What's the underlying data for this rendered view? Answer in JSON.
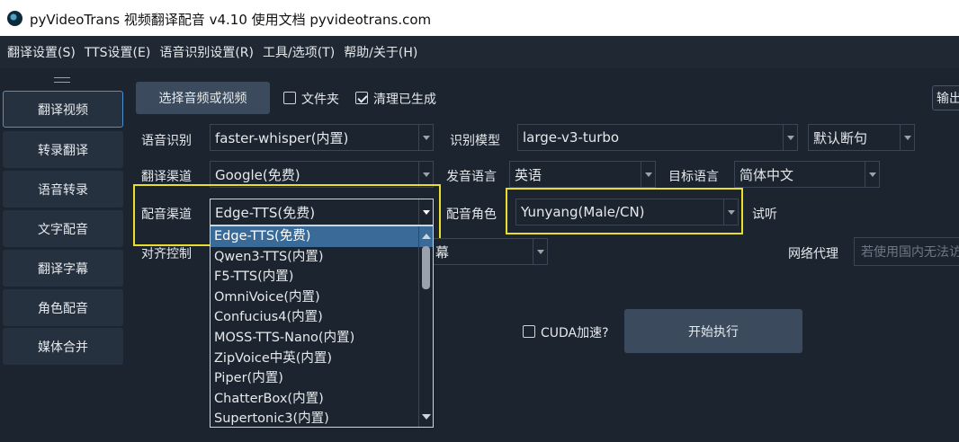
{
  "window": {
    "title": "pyVideoTrans 视频翻译配音 v4.10 使用文档 pyvideotrans.com"
  },
  "menu": [
    "翻译设置(S)",
    "TTS设置(E)",
    "语音识别设置(R)",
    "工具/选项(T)",
    "帮助/关于(H)"
  ],
  "sidebar": {
    "items": [
      {
        "label": "翻译视频",
        "active": true
      },
      {
        "label": "转录翻译"
      },
      {
        "label": "语音转录"
      },
      {
        "label": "文字配音"
      },
      {
        "label": "翻译字幕"
      },
      {
        "label": "角色配音"
      },
      {
        "label": "媒体合并"
      }
    ]
  },
  "top": {
    "select_button": "选择音频或视频",
    "folder_checkbox": "文件夹",
    "clear_checkbox": "清理已生成",
    "output_button": "输出"
  },
  "form": {
    "asr_label": "语音识别",
    "asr_value": "faster-whisper(内置)",
    "model_label": "识别模型",
    "model_value": "large-v3-turbo",
    "split_value": "默认断句",
    "translate_label": "翻译渠道",
    "translate_value": "Google(免费)",
    "source_lang_label": "发音语言",
    "source_lang_value": "英语",
    "target_lang_label": "目标语言",
    "target_lang_value": "简体中文",
    "dub_label": "配音渠道",
    "dub_value": "Edge-TTS(免费)",
    "role_label": "配音角色",
    "role_value": "Yunyang(Male/CN)",
    "listen_label": "试听",
    "align_label": "对齐控制",
    "subtitle_partial": "幕",
    "proxy_label": "网络代理",
    "proxy_placeholder": "若使用国内无法访"
  },
  "dropdown": {
    "options": [
      "Edge-TTS(免费)",
      "Qwen3-TTS(内置)",
      "F5-TTS(内置)",
      "OmniVoice(内置)",
      "Confucius4(内置)",
      "MOSS-TTS-Nano(内置)",
      "ZipVoice中英(内置)",
      "Piper(内置)",
      "ChatterBox(内置)",
      "Supertonic3(内置)"
    ],
    "selected_index": 0
  },
  "bottom": {
    "cuda_label": "CUDA加速?",
    "start_button": "开始执行"
  },
  "colors": {
    "highlight": "#e9de2b",
    "selection": "#3a6a98",
    "background": "#1b242f"
  }
}
